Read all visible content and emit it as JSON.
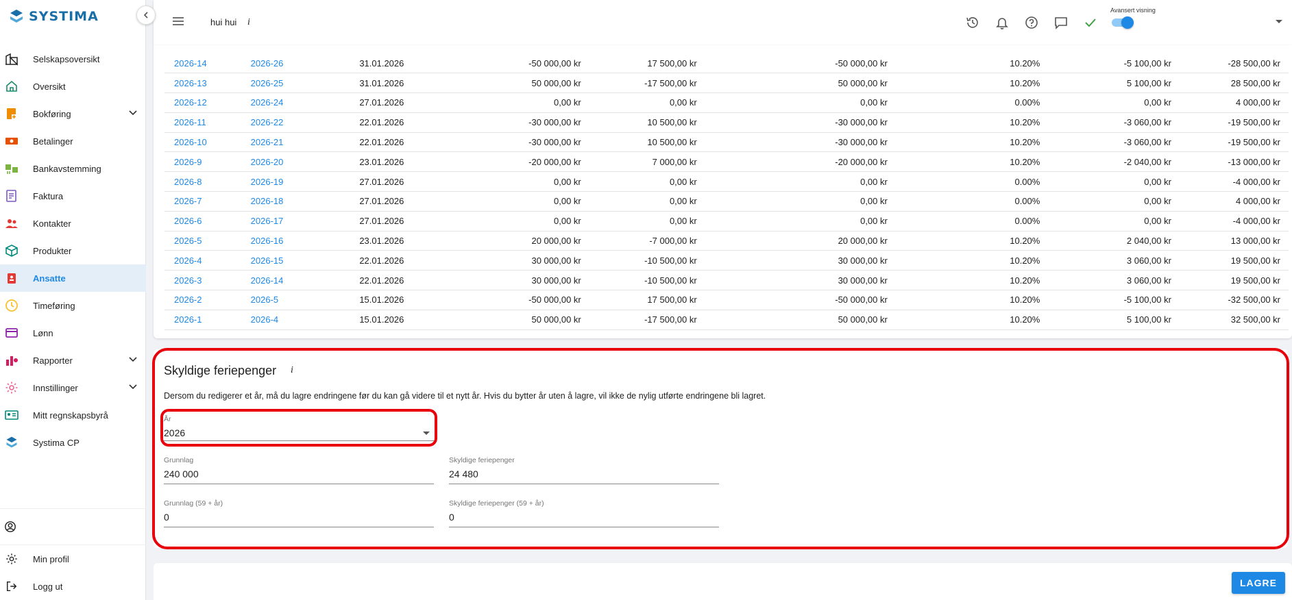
{
  "app": {
    "logo_text": "SYSTIMA"
  },
  "sidebar": {
    "items": [
      {
        "label": "Selskapsoversikt",
        "icon": "buildings-icon",
        "color": "#222222"
      },
      {
        "label": "Oversikt",
        "icon": "home-icon",
        "color": "#1a8a6a"
      },
      {
        "label": "Bokføring",
        "icon": "book-icon",
        "color": "#f08c00",
        "expandable": true
      },
      {
        "label": "Betalinger",
        "icon": "money-icon",
        "color": "#e65100"
      },
      {
        "label": "Bankavstemming",
        "icon": "bank-icon",
        "color": "#7cb342"
      },
      {
        "label": "Faktura",
        "icon": "invoice-icon",
        "color": "#7e57c2"
      },
      {
        "label": "Kontakter",
        "icon": "people-icon",
        "color": "#e53935"
      },
      {
        "label": "Produkter",
        "icon": "box-icon",
        "color": "#00897b"
      },
      {
        "label": "Ansatte",
        "icon": "badge-icon",
        "color": "#e53935",
        "active": true
      },
      {
        "label": "Timeføring",
        "icon": "clock-icon",
        "color": "#fbc02d"
      },
      {
        "label": "Lønn",
        "icon": "card-icon",
        "color": "#8e24aa"
      },
      {
        "label": "Rapporter",
        "icon": "chart-icon",
        "color": "#d81b60",
        "expandable": true
      },
      {
        "label": "Innstillinger",
        "icon": "gear-icon",
        "color": "#f06292",
        "expandable": true
      },
      {
        "label": "Mitt regnskapsbyrå",
        "icon": "id-card-icon",
        "color": "#00897b"
      },
      {
        "label": "Systima CP",
        "icon": "systima-icon",
        "color": "#1a6fa8"
      }
    ],
    "bottom": {
      "min_profil": "Min profil",
      "logg_ut": "Logg ut"
    }
  },
  "topbar": {
    "company": "hui hui",
    "info": "i",
    "advanced_view_label": "Avansert visning",
    "advanced_view_on": true
  },
  "table": {
    "rows": [
      [
        "2026-14",
        "2026-26",
        "31.01.2026",
        "-50 000,00 kr",
        "17 500,00 kr",
        "-50 000,00 kr",
        "10.20%",
        "-5 100,00 kr",
        "-28 500,00 kr"
      ],
      [
        "2026-13",
        "2026-25",
        "31.01.2026",
        "50 000,00 kr",
        "-17 500,00 kr",
        "50 000,00 kr",
        "10.20%",
        "5 100,00 kr",
        "28 500,00 kr"
      ],
      [
        "2026-12",
        "2026-24",
        "27.01.2026",
        "0,00 kr",
        "0,00 kr",
        "0,00 kr",
        "0.00%",
        "0,00 kr",
        "4 000,00 kr"
      ],
      [
        "2026-11",
        "2026-22",
        "22.01.2026",
        "-30 000,00 kr",
        "10 500,00 kr",
        "-30 000,00 kr",
        "10.20%",
        "-3 060,00 kr",
        "-19 500,00 kr"
      ],
      [
        "2026-10",
        "2026-21",
        "22.01.2026",
        "-30 000,00 kr",
        "10 500,00 kr",
        "-30 000,00 kr",
        "10.20%",
        "-3 060,00 kr",
        "-19 500,00 kr"
      ],
      [
        "2026-9",
        "2026-20",
        "23.01.2026",
        "-20 000,00 kr",
        "7 000,00 kr",
        "-20 000,00 kr",
        "10.20%",
        "-2 040,00 kr",
        "-13 000,00 kr"
      ],
      [
        "2026-8",
        "2026-19",
        "27.01.2026",
        "0,00 kr",
        "0,00 kr",
        "0,00 kr",
        "0.00%",
        "0,00 kr",
        "-4 000,00 kr"
      ],
      [
        "2026-7",
        "2026-18",
        "27.01.2026",
        "0,00 kr",
        "0,00 kr",
        "0,00 kr",
        "0.00%",
        "0,00 kr",
        "4 000,00 kr"
      ],
      [
        "2026-6",
        "2026-17",
        "27.01.2026",
        "0,00 kr",
        "0,00 kr",
        "0,00 kr",
        "0.00%",
        "0,00 kr",
        "-4 000,00 kr"
      ],
      [
        "2026-5",
        "2026-16",
        "23.01.2026",
        "20 000,00 kr",
        "-7 000,00 kr",
        "20 000,00 kr",
        "10.20%",
        "2 040,00 kr",
        "13 000,00 kr"
      ],
      [
        "2026-4",
        "2026-15",
        "22.01.2026",
        "30 000,00 kr",
        "-10 500,00 kr",
        "30 000,00 kr",
        "10.20%",
        "3 060,00 kr",
        "19 500,00 kr"
      ],
      [
        "2026-3",
        "2026-14",
        "22.01.2026",
        "30 000,00 kr",
        "-10 500,00 kr",
        "30 000,00 kr",
        "10.20%",
        "3 060,00 kr",
        "19 500,00 kr"
      ],
      [
        "2026-2",
        "2026-5",
        "15.01.2026",
        "-50 000,00 kr",
        "17 500,00 kr",
        "-50 000,00 kr",
        "10.20%",
        "-5 100,00 kr",
        "-32 500,00 kr"
      ],
      [
        "2026-1",
        "2026-4",
        "15.01.2026",
        "50 000,00 kr",
        "-17 500,00 kr",
        "50 000,00 kr",
        "10.20%",
        "5 100,00 kr",
        "32 500,00 kr"
      ]
    ]
  },
  "holiday_pay": {
    "title": "Skyldige feriepenger",
    "info": "i",
    "description": "Dersom du redigerer et år, må du lagre endringene før du kan gå videre til et nytt år. Hvis du bytter år uten å lagre, vil ikke de nylig utførte endringene bli lagret.",
    "year_label": "År",
    "year_value": "2026",
    "grunnlag_label": "Grunnlag",
    "grunnlag_value": "240 000",
    "skyldige_label": "Skyldige feriepenger",
    "skyldige_value": "24 480",
    "grunnlag59_label": "Grunnlag (59 + år)",
    "grunnlag59_value": "0",
    "skyldige59_label": "Skyldige feriepenger (59 + år)",
    "skyldige59_value": "0"
  },
  "actions": {
    "save_label": "LAGRE"
  },
  "colors": {
    "accent": "#1e88e5",
    "highlight": "#e8000b",
    "success": "#43a047"
  }
}
